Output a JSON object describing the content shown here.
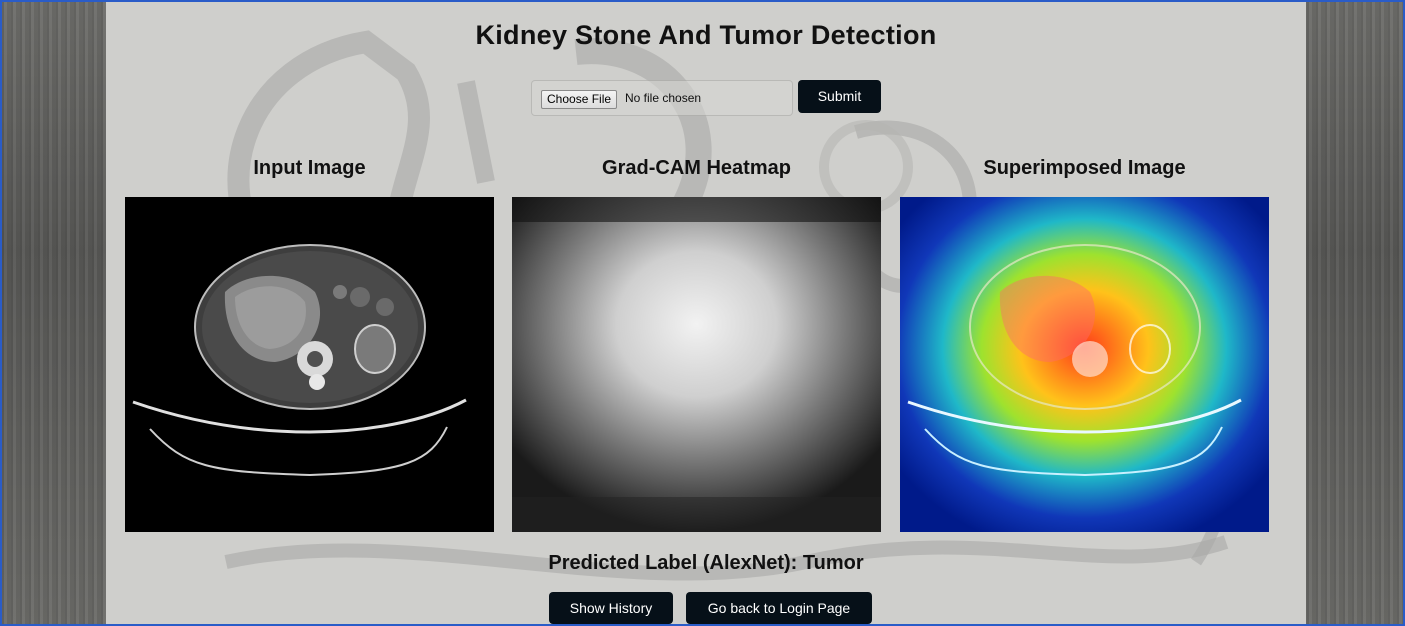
{
  "page": {
    "title": "Kidney Stone And Tumor Detection"
  },
  "upload": {
    "choose_label": "Choose File",
    "status": "No file chosen",
    "submit_label": "Submit"
  },
  "panels": [
    {
      "title": "Input Image"
    },
    {
      "title": "Grad-CAM Heatmap"
    },
    {
      "title": "Superimposed Image"
    }
  ],
  "prediction": {
    "text": "Predicted Label (AlexNet): Tumor"
  },
  "actions": {
    "history_label": "Show History",
    "login_label": "Go back to Login Page"
  },
  "colors": {
    "frame_border": "#2a5cc8",
    "button_bg": "#061018",
    "button_text": "#ffffff"
  }
}
